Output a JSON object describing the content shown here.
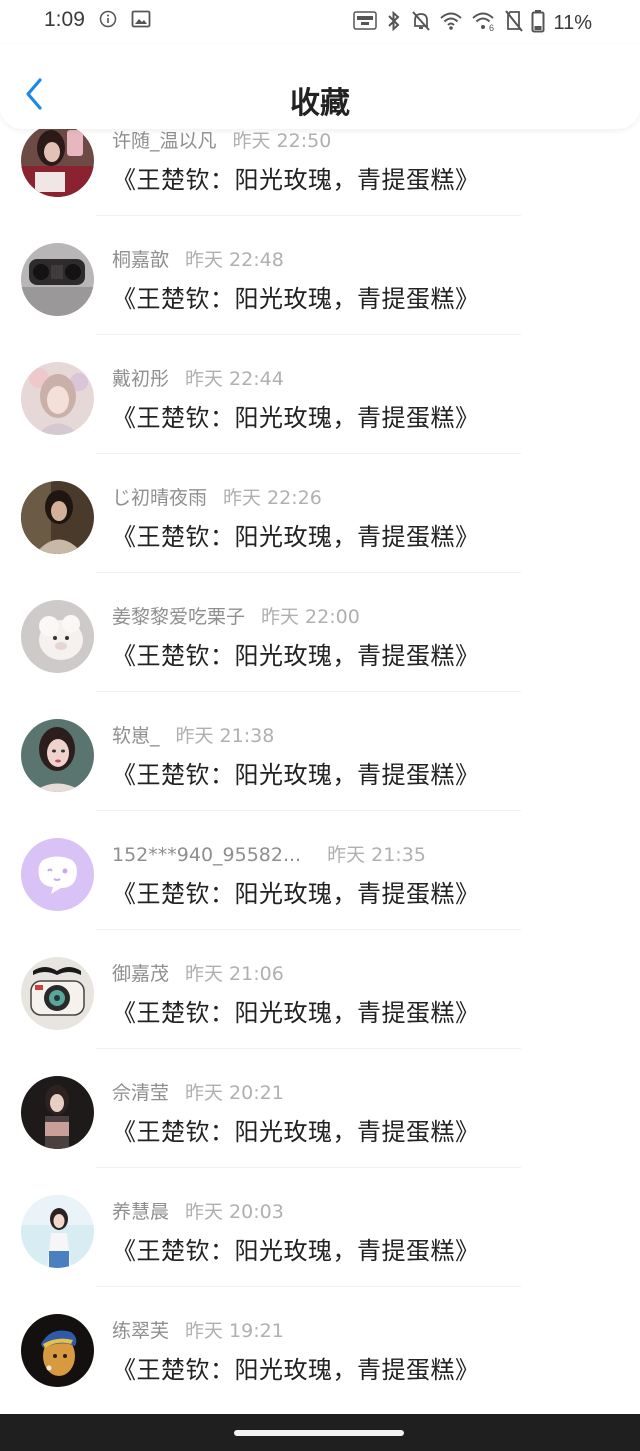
{
  "status_bar": {
    "time": "1:09",
    "battery": "11%",
    "icons": [
      "info-icon",
      "image-icon",
      "auto-hz-icon",
      "bluetooth-icon",
      "bell-off-icon",
      "wifi-icon",
      "wifi-6-icon",
      "no-sim-icon",
      "battery-icon"
    ]
  },
  "header": {
    "title": "收藏",
    "back_icon": "chevron-left-icon",
    "accent_color": "#1e88e5"
  },
  "items": [
    {
      "name": "许随_温以凡",
      "time": "昨天 22:50",
      "title": "《王楚钦：阳光玫瑰，青提蛋糕》",
      "avatar": "photo-avatar"
    },
    {
      "name": "桐嘉歆",
      "time": "昨天 22:48",
      "title": "《王楚钦：阳光玫瑰，青提蛋糕》",
      "avatar": "photo-avatar"
    },
    {
      "name": "戴初彤",
      "time": "昨天 22:44",
      "title": "《王楚钦：阳光玫瑰，青提蛋糕》",
      "avatar": "illustration-avatar"
    },
    {
      "name": "  じ初晴夜雨",
      "time": "昨天 22:26",
      "title": "《王楚钦：阳光玫瑰，青提蛋糕》",
      "avatar": "photo-avatar"
    },
    {
      "name": "姜黎黎爱吃栗子",
      "time": "昨天 22:00",
      "title": "《王楚钦：阳光玫瑰，青提蛋糕》",
      "avatar": "toy-avatar"
    },
    {
      "name": "软崽_",
      "time": "昨天 21:38",
      "title": "《王楚钦：阳光玫瑰，青提蛋糕》",
      "avatar": "photo-avatar"
    },
    {
      "name": "152***940_95582...",
      "time": "昨天 21:35",
      "title": "《王楚钦：阳光玫瑰，青提蛋糕》",
      "avatar": "default-chat-avatar"
    },
    {
      "name": "御嘉茂",
      "time": "昨天 21:06",
      "title": "《王楚钦：阳光玫瑰，青提蛋糕》",
      "avatar": "camera-avatar"
    },
    {
      "name": "佘清莹",
      "time": "昨天 20:21",
      "title": "《王楚钦：阳光玫瑰，青提蛋糕》",
      "avatar": "photo-avatar"
    },
    {
      "name": "养慧晨",
      "time": "昨天 20:03",
      "title": "《王楚钦：阳光玫瑰，青提蛋糕》",
      "avatar": "photo-avatar"
    },
    {
      "name": "练翠芙",
      "time": "昨天 19:21",
      "title": "《王楚钦：阳光玫瑰，青提蛋糕》",
      "avatar": "painting-avatar"
    }
  ]
}
